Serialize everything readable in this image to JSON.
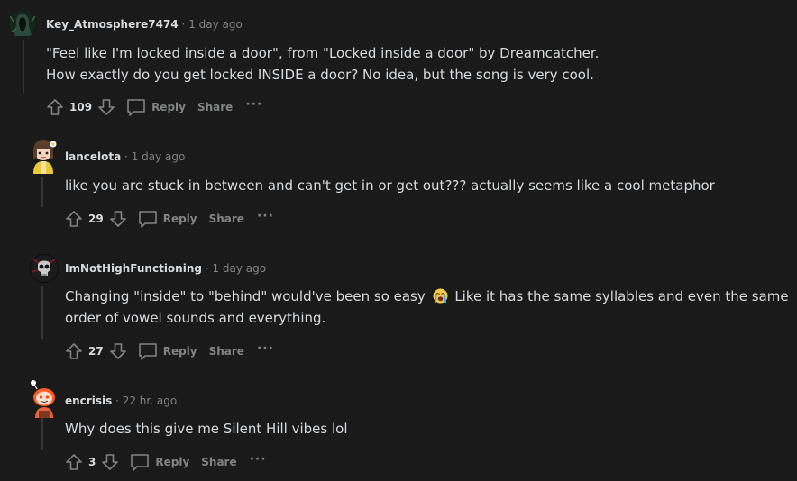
{
  "comments": [
    {
      "author": "Key_Atmosphere7474",
      "separator": "·",
      "time": "1 day ago",
      "lines": [
        "\"Feel like I'm locked inside a door\", from \"Locked inside a door\" by Dreamcatcher.",
        "How exactly do you get locked INSIDE a door? No idea, but the song is very cool."
      ],
      "score": "109",
      "reply_label": "Reply",
      "share_label": "Share",
      "more_label": "···",
      "avatar": "hooded-figure-avatar"
    },
    {
      "author": "lancelota",
      "separator": "·",
      "time": "1 day ago",
      "lines": [
        "like you are stuck in between and can't get in or get out??? actually seems like a cool metaphor"
      ],
      "score": "29",
      "reply_label": "Reply",
      "share_label": "Share",
      "more_label": "···",
      "avatar": "yellow-outfit-avatar"
    },
    {
      "author": "ImNotHighFunctioning",
      "separator": "·",
      "time": "1 day ago",
      "line1_before": "Changing \"inside\" to \"behind\" would've been so easy",
      "line1_after": "Like it has the same syllables and even the same",
      "line2": "order of vowel sounds and everything.",
      "emoji": "loudly-crying-face-emoji",
      "score": "27",
      "reply_label": "Reply",
      "share_label": "Share",
      "more_label": "···",
      "avatar": "dark-skull-avatar"
    },
    {
      "author": "encrisis",
      "separator": "·",
      "time": "22 hr. ago",
      "lines": [
        "Why does this give me Silent Hill vibes lol"
      ],
      "score": "3",
      "reply_label": "Reply",
      "share_label": "Share",
      "more_label": "···",
      "avatar": "orange-snoo-avatar"
    }
  ],
  "colors": {
    "background": "#1a1a1b",
    "text": "#d7dadc",
    "muted": "#818384",
    "thread_line": "#343536"
  },
  "icons": [
    "upvote-icon",
    "downvote-icon",
    "comment-bubble-icon",
    "more-options-icon"
  ]
}
